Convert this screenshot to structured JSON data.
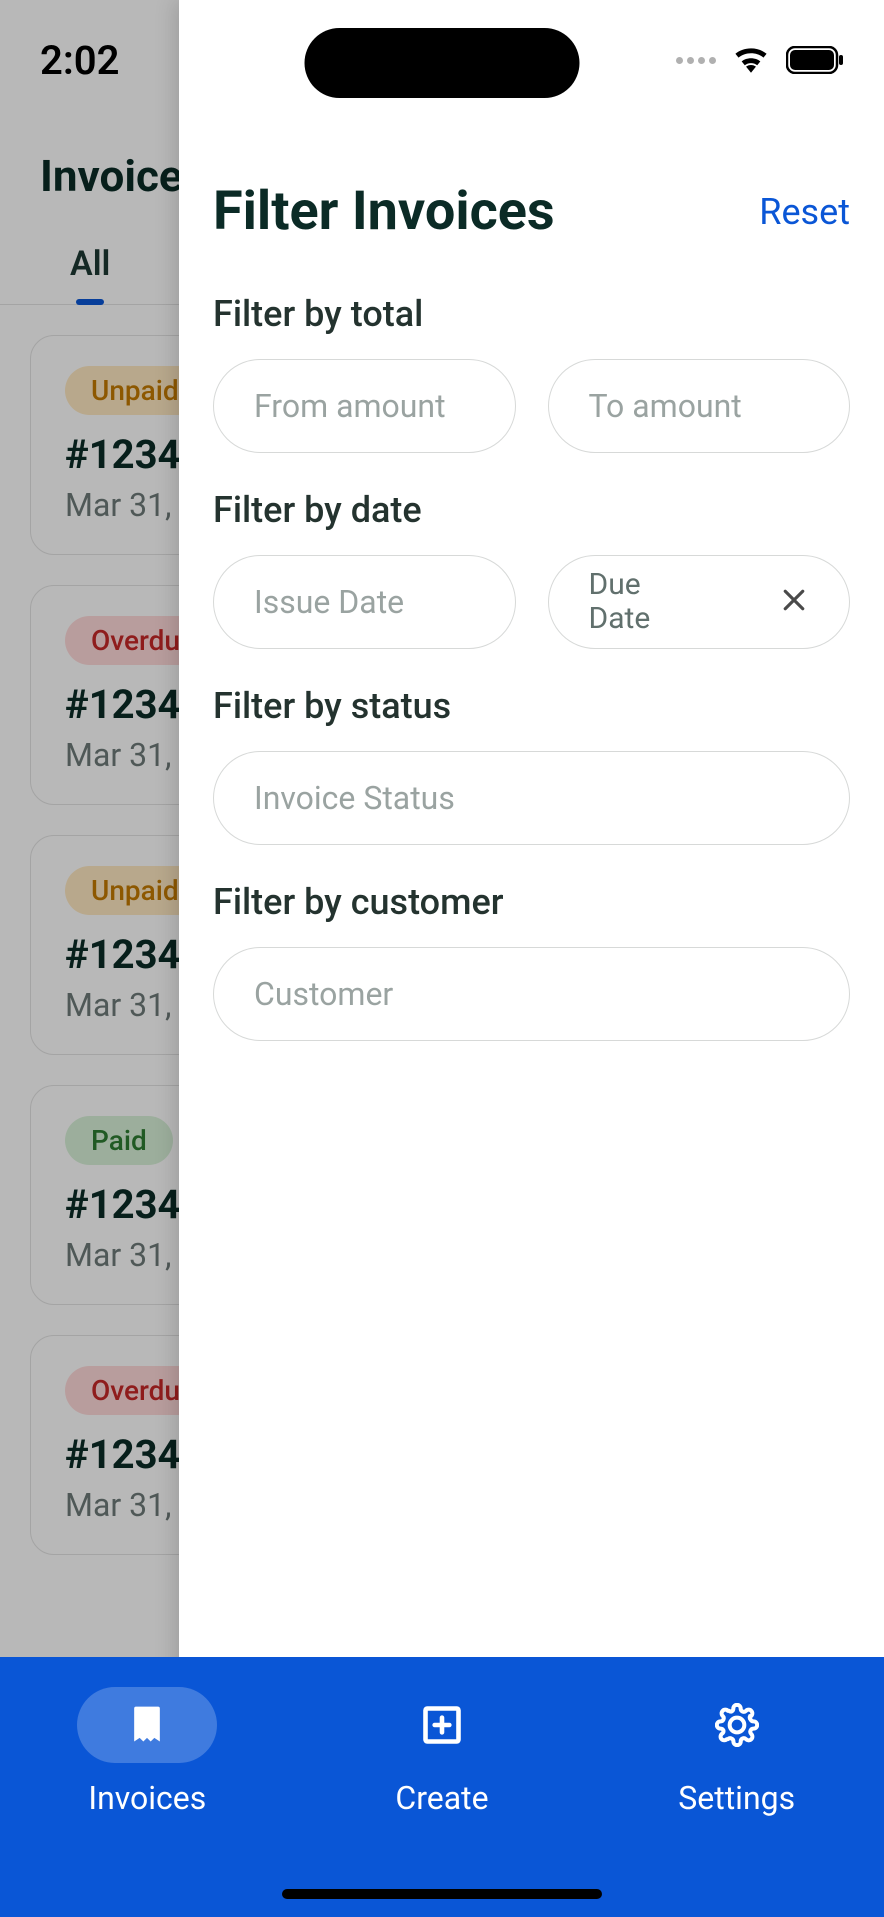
{
  "status": {
    "time": "2:02"
  },
  "page": {
    "title": "Invoices",
    "tabs": [
      {
        "label": "All"
      }
    ],
    "invoices": [
      {
        "status": "Unpaid",
        "badgeClass": "badge-unpaid",
        "number": "#1234",
        "date": "Mar 31,"
      },
      {
        "status": "Overdue",
        "badgeClass": "badge-overdue",
        "number": "#1234",
        "date": "Mar 31,"
      },
      {
        "status": "Unpaid",
        "badgeClass": "badge-unpaid",
        "number": "#1234",
        "date": "Mar 31,"
      },
      {
        "status": "Paid",
        "badgeClass": "badge-paid",
        "number": "#1234",
        "date": "Mar 31,"
      },
      {
        "status": "Overdue",
        "badgeClass": "badge-overdue",
        "number": "#1234",
        "date": "Mar 31,"
      }
    ]
  },
  "drawer": {
    "title": "Filter Invoices",
    "reset": "Reset",
    "sections": {
      "total": {
        "label": "Filter by total",
        "from_placeholder": "From amount",
        "to_placeholder": "To amount"
      },
      "date": {
        "label": "Filter by date",
        "issue_placeholder": "Issue Date",
        "due_label": "Due\nDate"
      },
      "status": {
        "label": "Filter by status",
        "placeholder": "Invoice Status"
      },
      "customer": {
        "label": "Filter by customer",
        "placeholder": "Customer"
      }
    },
    "apply_label": "Filter Invoices"
  },
  "nav": {
    "items": [
      {
        "label": "Invoices"
      },
      {
        "label": "Create"
      },
      {
        "label": "Settings"
      }
    ]
  }
}
